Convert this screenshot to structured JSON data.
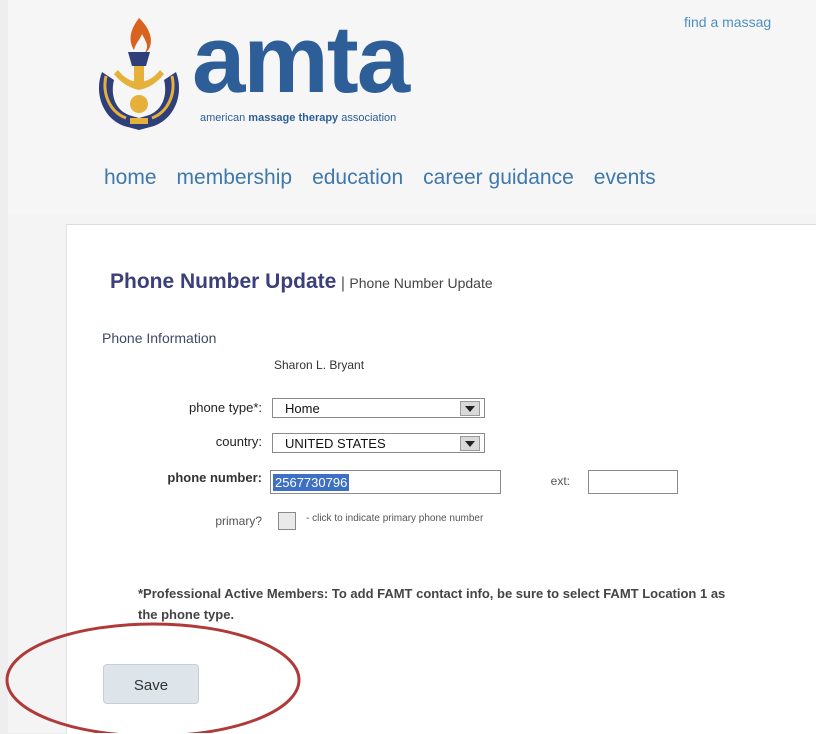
{
  "header": {
    "logo_word": "amta",
    "tagline_pre": "american ",
    "tagline_bold": "massage therapy",
    "tagline_post": " association",
    "top_link": "find a massag",
    "nav": [
      "home",
      "membership",
      "education",
      "career guidance",
      "events"
    ]
  },
  "page": {
    "title": "Phone Number Update",
    "separator": "|",
    "subtitle": "Phone Number Update"
  },
  "form": {
    "section_label": "Phone Information",
    "member_name": "Sharon L. Bryant",
    "phone_type_label": "phone type*:",
    "phone_type_value": "Home",
    "country_label": "country:",
    "country_value": "UNITED STATES",
    "phone_number_label": "phone number:",
    "phone_number_value": "2567730796",
    "ext_label": "ext:",
    "ext_value": "",
    "primary_label": "primary?",
    "primary_hint": "- click to indicate primary phone number",
    "note": "*Professional Active Members: To add FAMT contact info, be sure to select FAMT Location 1 as the phone type.",
    "save_label": "Save"
  },
  "colors": {
    "brand_blue": "#2d5e97",
    "nav_blue": "#3e78ad",
    "title_navy": "#3b3f7a",
    "annotation_red": "#b03a3a",
    "selection_blue": "#3d6fc4"
  }
}
